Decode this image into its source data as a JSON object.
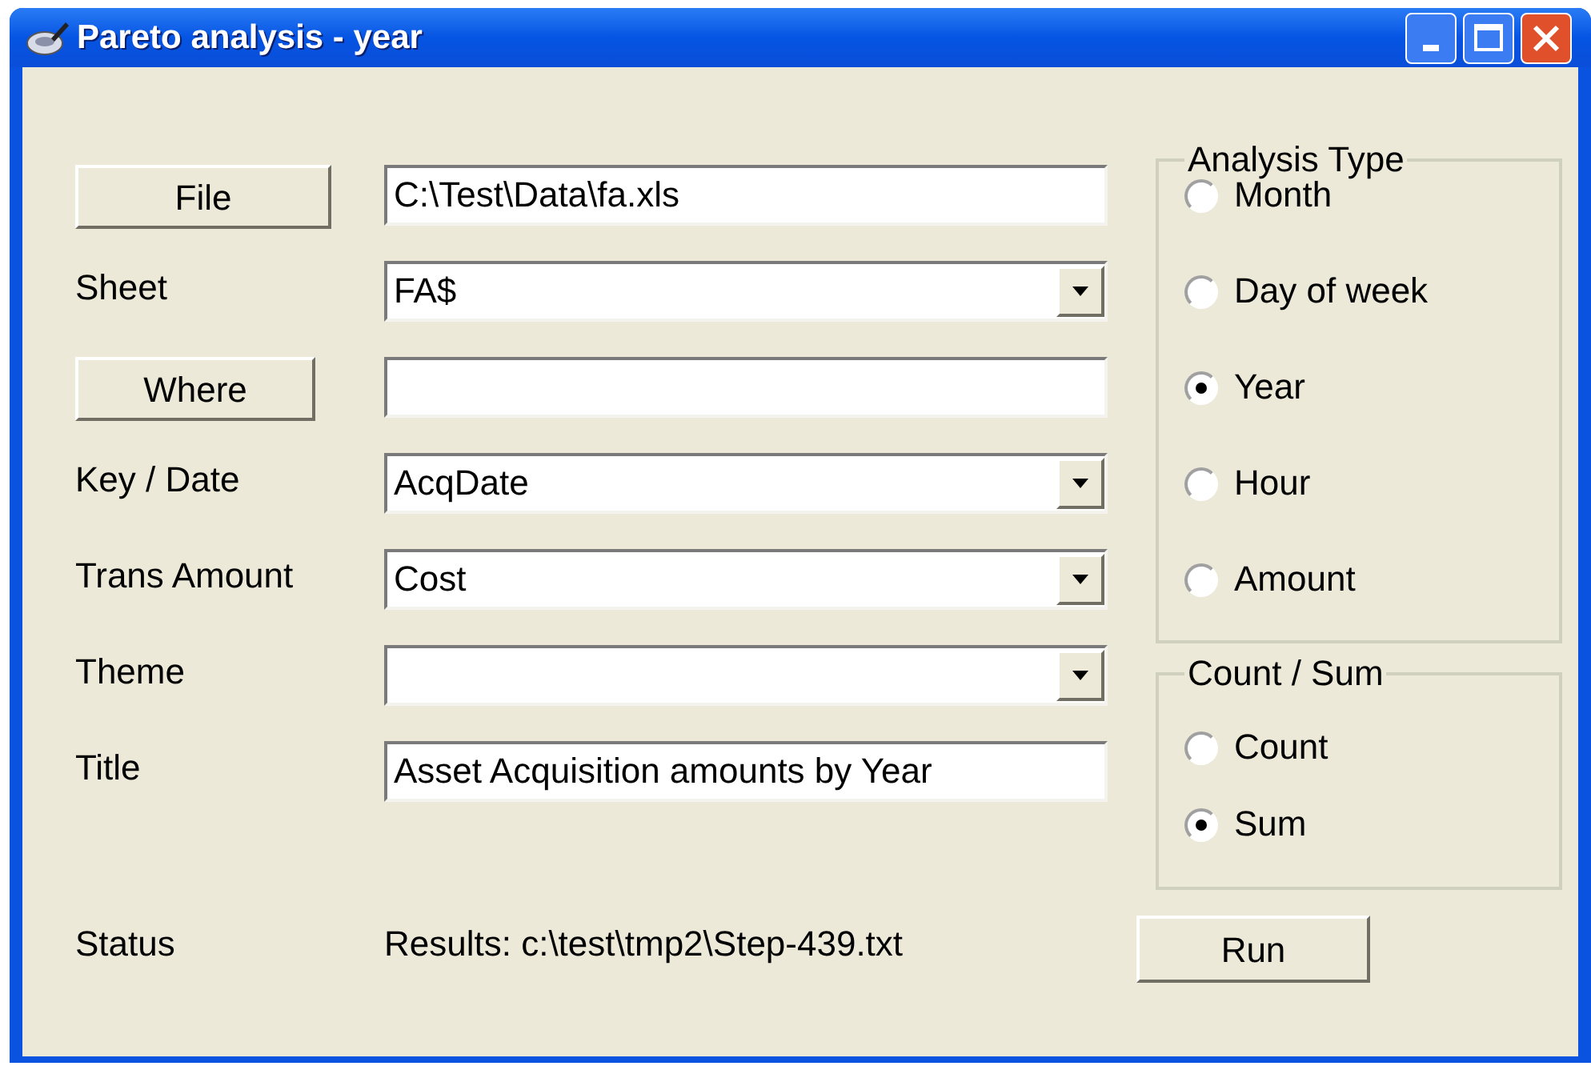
{
  "window": {
    "title": "Pareto analysis - year"
  },
  "form": [
    {
      "label": {
        "kind": "button",
        "text": "File"
      },
      "field": {
        "kind": "text",
        "value": "C:\\Test\\Data\\fa.xls"
      }
    },
    {
      "label": {
        "kind": "text",
        "text": "Sheet"
      },
      "field": {
        "kind": "combo",
        "value": "FA$"
      }
    },
    {
      "label": {
        "kind": "button",
        "text": "Where"
      },
      "field": {
        "kind": "text"
      }
    },
    {
      "label": {
        "kind": "text",
        "text": "Key / Date"
      },
      "field": {
        "kind": "combo",
        "value": "AcqDate"
      }
    },
    {
      "label": {
        "kind": "text",
        "text": "Trans Amount"
      },
      "field": {
        "kind": "combo",
        "value": "Cost"
      }
    },
    {
      "label": {
        "kind": "text",
        "text": "Theme"
      },
      "field": {
        "kind": "combo"
      }
    },
    {
      "label": {
        "kind": "text",
        "text": "Title"
      },
      "field": {
        "kind": "text",
        "value": "Asset Acquisition amounts by Year"
      }
    }
  ],
  "groups": [
    {
      "legend": "Analysis Type",
      "options": [
        {
          "label": "Month",
          "selected": false
        },
        {
          "label": "Day of week",
          "selected": false
        },
        {
          "label": "Year",
          "selected": true
        },
        {
          "label": "Hour",
          "selected": false
        },
        {
          "label": "Amount",
          "selected": false
        }
      ]
    },
    {
      "legend": "Count / Sum",
      "options": [
        {
          "label": "Count",
          "selected": false
        },
        {
          "label": "Sum",
          "selected": true
        }
      ]
    }
  ],
  "status": {
    "label": "Status",
    "text": "Results: c:\\test\\tmp2\\Step-439.txt"
  },
  "run_button": "Run"
}
